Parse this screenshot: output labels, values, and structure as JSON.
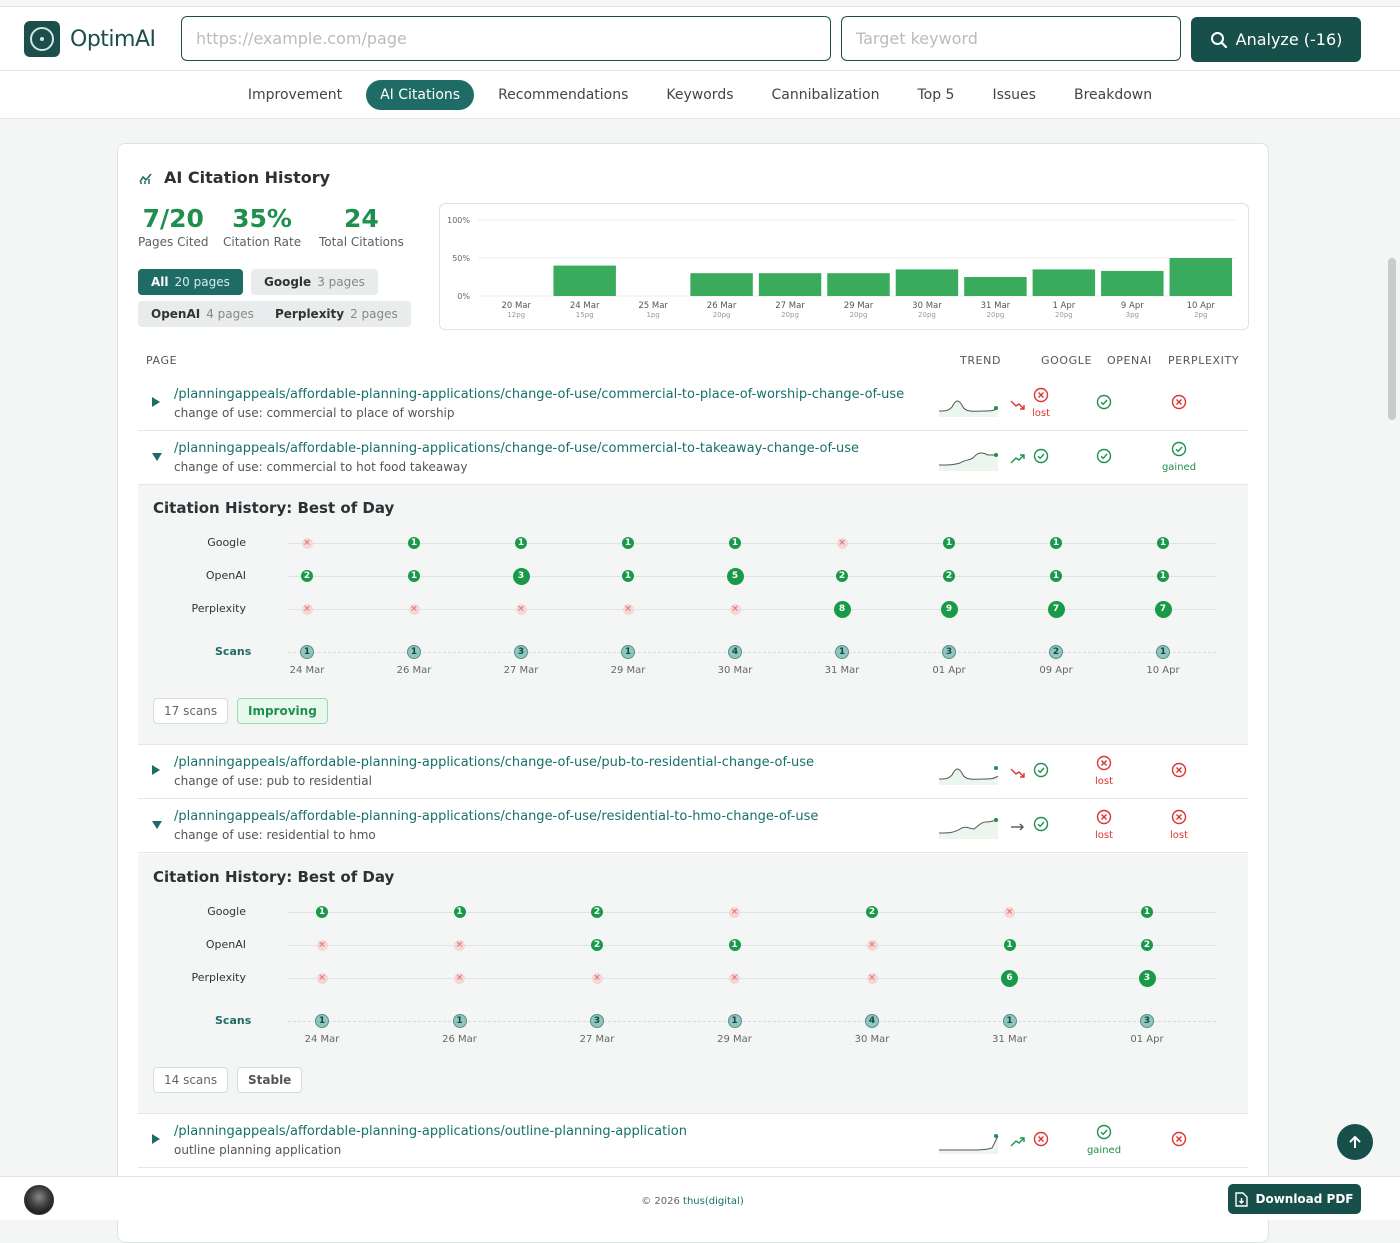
{
  "header": {
    "logo_text": "OptimAI",
    "url_placeholder": "https://example.com/page",
    "keyword_placeholder": "Target keyword",
    "analyze_label": "Analyze (-16)"
  },
  "tabs": [
    "Improvement",
    "AI Citations",
    "Recommendations",
    "Keywords",
    "Cannibalization",
    "Top 5",
    "Issues",
    "Breakdown"
  ],
  "active_tab": "AI Citations",
  "card": {
    "title": "AI Citation History",
    "stats": [
      {
        "value": "7/20",
        "label": "Pages Cited"
      },
      {
        "value": "35%",
        "label": "Citation Rate"
      },
      {
        "value": "24",
        "label": "Total Citations"
      }
    ],
    "filters": [
      {
        "name": "All",
        "count": "20 pages",
        "active": true
      },
      {
        "name": "Google",
        "count": "3 pages",
        "active": false
      },
      {
        "name": "OpenAI",
        "count": "4 pages",
        "active": false
      },
      {
        "name": "Perplexity",
        "count": "2 pages",
        "active": false
      }
    ]
  },
  "chart_data": {
    "type": "bar",
    "y_ticks": [
      "100%",
      "50%",
      "0%"
    ],
    "ylim": [
      0,
      100
    ],
    "categories": [
      "20 Mar",
      "24 Mar",
      "25 Mar",
      "26 Mar",
      "27 Mar",
      "29 Mar",
      "30 Mar",
      "31 Mar",
      "1 Apr",
      "9 Apr",
      "10 Apr"
    ],
    "sublabels": [
      "12pg",
      "15pg",
      "1pg",
      "20pg",
      "20pg",
      "20pg",
      "20pg",
      "20pg",
      "20pg",
      "3pg",
      "2pg"
    ],
    "values": [
      0,
      40,
      0,
      30,
      30,
      30,
      35,
      25,
      35,
      33,
      50
    ],
    "color": "#3aaa5c"
  },
  "table": {
    "headers": {
      "page": "PAGE",
      "trend": "TREND",
      "google": "GOOGLE",
      "openai": "OPENAI",
      "perplexity": "PERPLEXITY"
    },
    "rows": [
      {
        "url": "/planningappeals/affordable-planning-applications/change-of-use/commercial-to-place-of-worship-change-of-use",
        "desc": "change of use: commercial to place of worship",
        "trend": "down",
        "google": "lost",
        "openai": "yes",
        "perplexity": "no",
        "expanded": false
      },
      {
        "url": "/planningappeals/affordable-planning-applications/change-of-use/commercial-to-takeaway-change-of-use",
        "desc": "change of use: commercial to hot food takeaway",
        "trend": "up",
        "google": "yes",
        "openai": "yes",
        "perplexity": "gained",
        "expanded": true
      },
      {
        "url": "/planningappeals/affordable-planning-applications/change-of-use/pub-to-residential-change-of-use",
        "desc": "change of use: pub to residential",
        "trend": "down",
        "google": "yes",
        "openai": "lost",
        "perplexity": "no",
        "expanded": false
      },
      {
        "url": "/planningappeals/affordable-planning-applications/change-of-use/residential-to-hmo-change-of-use",
        "desc": "change of use: residential to hmo",
        "trend": "flat",
        "google": "yes",
        "openai": "lost",
        "perplexity": "lost",
        "expanded": true
      },
      {
        "url": "/planningappeals/affordable-planning-applications/outline-planning-application",
        "desc": "outline planning application",
        "trend": "up",
        "google": "no",
        "openai": "gained",
        "perplexity": "no",
        "expanded": false
      }
    ],
    "status_labels": {
      "lost": "lost",
      "gained": "gained"
    }
  },
  "details": [
    {
      "title": "Citation History: Best of Day",
      "dates": [
        "24 Mar",
        "26 Mar",
        "27 Mar",
        "29 Mar",
        "30 Mar",
        "31 Mar",
        "01 Apr",
        "09 Apr",
        "10 Apr"
      ],
      "google": [
        "x",
        "1",
        "1",
        "1",
        "1",
        "x",
        "1",
        "1",
        "1"
      ],
      "openai": [
        "2",
        "1",
        "3",
        "1",
        "5",
        "2",
        "2",
        "1",
        "1"
      ],
      "perplexity": [
        "x",
        "x",
        "x",
        "x",
        "x",
        "8",
        "9",
        "7",
        "7"
      ],
      "scans": [
        "1",
        "1",
        "3",
        "1",
        "4",
        "1",
        "3",
        "2",
        "1"
      ],
      "scan_count": "17 scans",
      "status": "Improving"
    },
    {
      "title": "Citation History: Best of Day",
      "dates": [
        "24 Mar",
        "26 Mar",
        "27 Mar",
        "29 Mar",
        "30 Mar",
        "31 Mar",
        "01 Apr"
      ],
      "google": [
        "1",
        "1",
        "2",
        "x",
        "2",
        "x",
        "1"
      ],
      "openai": [
        "x",
        "x",
        "2",
        "1",
        "x",
        "1",
        "2"
      ],
      "perplexity": [
        "x",
        "x",
        "x",
        "x",
        "x",
        "6",
        "3"
      ],
      "scans": [
        "1",
        "1",
        "3",
        "1",
        "4",
        "1",
        "3"
      ],
      "scan_count": "14 scans",
      "status": "Stable"
    }
  ],
  "platform_labels": {
    "google": "Google",
    "openai": "OpenAI",
    "perplexity": "Perplexity",
    "scans": "Scans"
  },
  "footer": {
    "copyright": "© 2026 ",
    "brand": "thus(digital)",
    "download_label": "Download PDF"
  }
}
